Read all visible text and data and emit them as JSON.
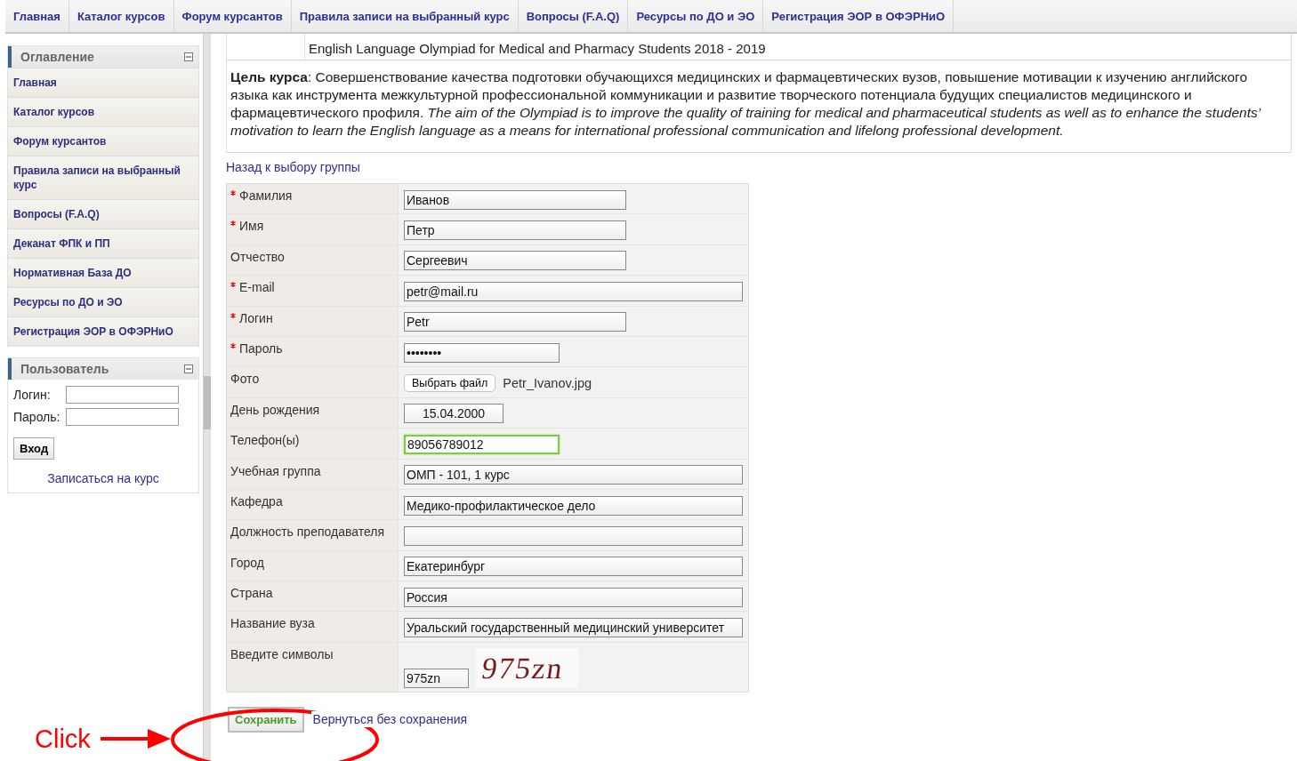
{
  "nav": [
    {
      "label": "Главная"
    },
    {
      "label": "Каталог курсов"
    },
    {
      "label": "Форум курсантов"
    },
    {
      "label": "Правила записи на выбранный курс"
    },
    {
      "label": "Вопросы (F.A.Q)"
    },
    {
      "label": "Ресурсы по ДО и ЭО"
    },
    {
      "label": "Регистрация ЭОР в ОФЭРНиО"
    }
  ],
  "sidebar": {
    "toc": {
      "title": "Оглавление",
      "items": [
        {
          "label": "Главная"
        },
        {
          "label": "Каталог курсов"
        },
        {
          "label": "Форум курсантов"
        },
        {
          "label": "Правила записи на выбранный курс"
        },
        {
          "label": "Вопросы (F.A.Q)"
        },
        {
          "label": "Деканат ФПК и ПП"
        },
        {
          "label": "Нормативная База ДО"
        },
        {
          "label": "Ресурсы по ДО и ЭО"
        },
        {
          "label": "Регистрация ЭОР в ОФЭРНиО"
        }
      ]
    },
    "user": {
      "title": "Пользователь",
      "login_label": "Логин:",
      "password_label": "Пароль:",
      "login_button": "Вход",
      "enroll_link": "Записаться на курс"
    }
  },
  "course": {
    "line": "English Language Olympiad for Medical and Pharmacy Students 2018 - 2019",
    "goal": "**Цель курса**: Совершенствование качества подготовки обучающихся медицинских и фармацевтических вузов, повышение мотивации к изучению английского языка как инструмента межкультурной профессиональной коммуникации и развитие творческого потенциала будущих специалистов медицинского и фармацевтического профиля. *The aim of the Olympiad is to improve the quality of training for medical and pharmaceutical students as well as to enhance the students’ motivation to learn the English language as a means for international professional communication and lifelong professional development.*"
  },
  "back_link": "Назад к выбору группы",
  "form": {
    "fields": [
      {
        "label": "Фамилия",
        "required": true,
        "kind": "short",
        "value": "Иванов",
        "focused": false
      },
      {
        "label": "Имя",
        "required": true,
        "kind": "short",
        "value": "Петр",
        "focused": false
      },
      {
        "label": "Отчество",
        "required": false,
        "kind": "short",
        "value": "Сергеевич",
        "focused": false
      },
      {
        "label": "E-mail",
        "required": true,
        "kind": "long",
        "value": "petr@mail.ru",
        "focused": false
      },
      {
        "label": "Логин",
        "required": true,
        "kind": "short",
        "value": "Petr",
        "focused": false
      },
      {
        "label": "Пароль",
        "required": true,
        "kind": "medium",
        "value": "••••••••",
        "focused": false
      },
      {
        "label": "Фото",
        "required": false,
        "kind": "file",
        "button_label": "Выбрать файл",
        "value": "Petr_Ivanov.jpg",
        "focused": false
      },
      {
        "label": "День рождения",
        "required": false,
        "kind": "date",
        "value": "15.04.2000",
        "focused": false
      },
      {
        "label": "Телефон(ы)",
        "required": false,
        "kind": "medium",
        "value": "89056789012",
        "focused": true
      },
      {
        "label": "Учебная группа",
        "required": false,
        "kind": "long",
        "value": "ОМП - 101, 1 курс",
        "focused": false
      },
      {
        "label": "Кафедра",
        "required": false,
        "kind": "long",
        "value": "Медико-профилактическое дело",
        "focused": false
      },
      {
        "label": "Должность преподавателя",
        "required": false,
        "kind": "long",
        "focused": false
      },
      {
        "label": "Город",
        "required": false,
        "kind": "long",
        "value": "Екатеринбург",
        "focused": false
      },
      {
        "label": "Страна",
        "required": false,
        "kind": "long",
        "value": "Россия",
        "focused": false
      },
      {
        "label": "Название вуза",
        "required": false,
        "kind": "long",
        "value": "Уральский государственный медицинский университет",
        "focused": false
      },
      {
        "label": "Введите символы",
        "required": false,
        "kind": "captcha",
        "value": "975zn",
        "captcha_text": "975zn",
        "focused": false
      }
    ]
  },
  "actions": {
    "save": "Сохранить",
    "cancel": "Вернуться без сохранения"
  },
  "annotation": {
    "text": "Click"
  }
}
